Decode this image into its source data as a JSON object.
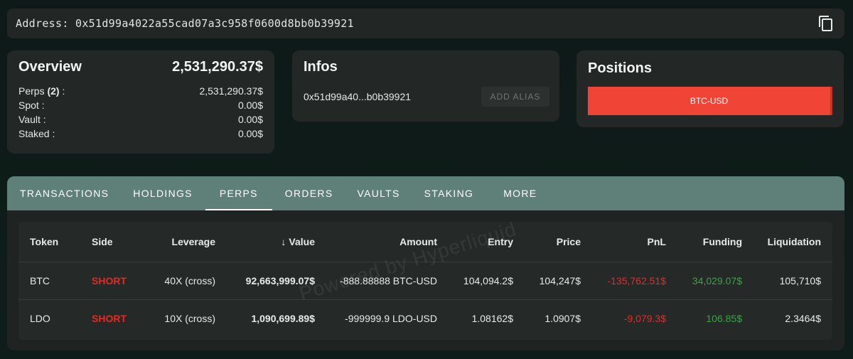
{
  "address_bar": {
    "label": "Address:",
    "address": "0x51d99a4022a55cad07a3c958f0600d8bb0b39921",
    "copy_icon": "copy-icon"
  },
  "overview": {
    "title": "Overview",
    "total": "2,531,290.37$",
    "rows": [
      {
        "label": "Perps",
        "count": "(2)",
        "suffix": " :",
        "value": "2,531,290.37$"
      },
      {
        "label": "Spot :",
        "value": "0.00$"
      },
      {
        "label": "Vault :",
        "value": "0.00$"
      },
      {
        "label": "Staked :",
        "value": "0.00$"
      }
    ]
  },
  "infos": {
    "title": "Infos",
    "short_address": "0x51d99a40...b0b39921",
    "add_alias_label": "ADD ALIAS"
  },
  "positions": {
    "title": "Positions",
    "bar_label": "BTC-USD",
    "bar_color": "#f04437"
  },
  "tabs": [
    {
      "label": "TRANSACTIONS"
    },
    {
      "label": "HOLDINGS"
    },
    {
      "label": "PERPS",
      "active": true
    },
    {
      "label": "ORDERS"
    },
    {
      "label": "VAULTS"
    },
    {
      "label": "STAKING"
    },
    {
      "label": "MORE"
    }
  ],
  "table": {
    "headers": [
      "Token",
      "Side",
      "Leverage",
      "Value",
      "Amount",
      "Entry",
      "Price",
      "PnL",
      "Funding",
      "Liquidation"
    ],
    "sort_icon": "arrow-down-icon",
    "rows": [
      {
        "token": "BTC",
        "side": "SHORT",
        "leverage": "40X (cross)",
        "value": "92,663,999.07$",
        "amount": "-888.88888 BTC-USD",
        "entry": "104,094.2$",
        "price": "104,247$",
        "pnl": "-135,762.51$",
        "funding": "34,029.07$",
        "liquidation": "105,710$"
      },
      {
        "token": "LDO",
        "side": "SHORT",
        "leverage": "10X (cross)",
        "value": "1,090,699.89$",
        "amount": "-999999.9 LDO-USD",
        "entry": "1.08162$",
        "price": "1.0907$",
        "pnl": "-9,079.3$",
        "funding": "106.85$",
        "liquidation": "2.3464$"
      }
    ]
  },
  "watermark": "Powered by Hyperliquid",
  "colors": {
    "short": "#e42a23",
    "pnl_negative": "#e12d28",
    "funding_positive": "#3ea145",
    "tab_bar": "#5e8079"
  }
}
